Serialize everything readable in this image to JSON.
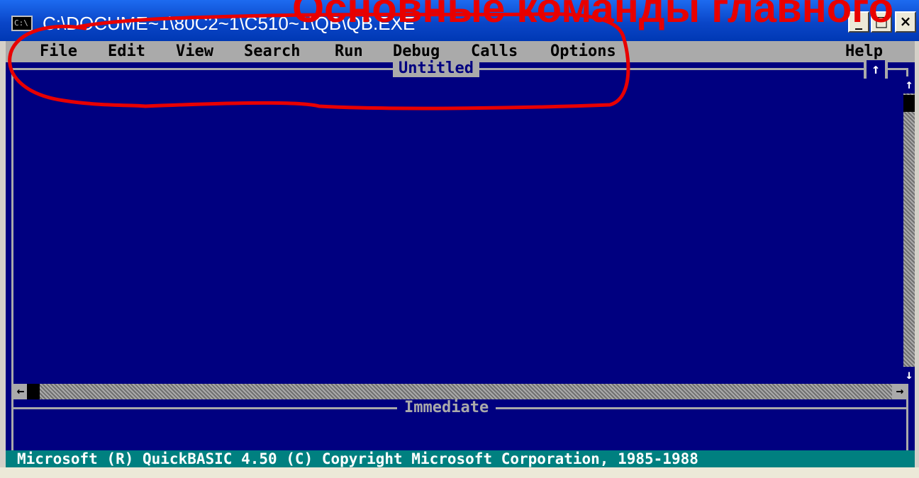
{
  "window": {
    "title": "C:\\DOCUME~1\\80C2~1\\C510~1\\QB\\QB.EXE",
    "console_icon": "C:\\",
    "minimize_label": "_",
    "maximize_label": "□",
    "close_label": "×"
  },
  "overlay_heading": "Основные команды главного",
  "menu": {
    "items": [
      "File",
      "Edit",
      "View",
      "Search",
      "Run",
      "Debug",
      "Calls",
      "Options"
    ],
    "help": "Help"
  },
  "editor": {
    "title": "Untitled",
    "maximize_marker": "↑",
    "scroll_up": "↑",
    "scroll_down": "↓",
    "scroll_left": "←",
    "scroll_right": "→"
  },
  "immediate": {
    "title": "Immediate"
  },
  "status": {
    "text": "Microsoft (R) QuickBASIC 4.50 (C) Copyright Microsoft Corporation, 1985-1988"
  },
  "colors": {
    "screen_background": "#000080",
    "menu_background": "#aaaaaa",
    "status_background": "#008080",
    "annotation": "#e80000"
  }
}
